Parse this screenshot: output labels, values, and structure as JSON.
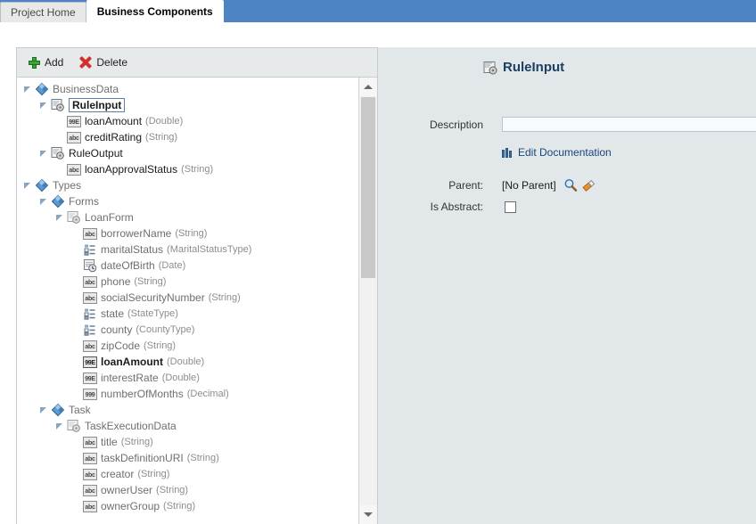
{
  "tabs": [
    {
      "label": "Project Home",
      "active": false
    },
    {
      "label": "Business Components",
      "active": true
    }
  ],
  "toolbar": {
    "add_label": "Add",
    "delete_label": "Delete"
  },
  "tree": [
    {
      "label": "BusinessData",
      "type": "",
      "indent": 0,
      "icon": "diamond",
      "twisty": "open",
      "dim": true
    },
    {
      "label": "RuleInput",
      "type": "",
      "indent": 1,
      "icon": "gear",
      "twisty": "open",
      "selected": true
    },
    {
      "label": "loanAmount",
      "type": "(Double)",
      "indent": 2,
      "icon": "num-double",
      "twisty": "none"
    },
    {
      "label": "creditRating",
      "type": "(String)",
      "indent": 2,
      "icon": "abc",
      "twisty": "none"
    },
    {
      "label": "RuleOutput",
      "type": "",
      "indent": 1,
      "icon": "gear",
      "twisty": "open"
    },
    {
      "label": "loanApprovalStatus",
      "type": "(String)",
      "indent": 2,
      "icon": "abc",
      "twisty": "none"
    },
    {
      "label": "Types",
      "type": "",
      "indent": 0,
      "icon": "diamond",
      "twisty": "open",
      "dim": true
    },
    {
      "label": "Forms",
      "type": "",
      "indent": 1,
      "icon": "diamond",
      "twisty": "open",
      "dim": true
    },
    {
      "label": "LoanForm",
      "type": "",
      "indent": 2,
      "icon": "gear-gray",
      "twisty": "open",
      "dim": true
    },
    {
      "label": "borrowerName",
      "type": "(String)",
      "indent": 3,
      "icon": "abc",
      "twisty": "none",
      "dim": true
    },
    {
      "label": "maritalStatus",
      "type": "(MaritalStatusType)",
      "indent": 3,
      "icon": "enum",
      "twisty": "none",
      "dim": true
    },
    {
      "label": "dateOfBirth",
      "type": "(Date)",
      "indent": 3,
      "icon": "date",
      "twisty": "none",
      "dim": true
    },
    {
      "label": "phone",
      "type": "(String)",
      "indent": 3,
      "icon": "abc",
      "twisty": "none",
      "dim": true
    },
    {
      "label": "socialSecurityNumber",
      "type": "(String)",
      "indent": 3,
      "icon": "abc",
      "twisty": "none",
      "dim": true
    },
    {
      "label": "state",
      "type": "(StateType)",
      "indent": 3,
      "icon": "enum",
      "twisty": "none",
      "dim": true
    },
    {
      "label": "county",
      "type": "(CountyType)",
      "indent": 3,
      "icon": "enum",
      "twisty": "none",
      "dim": true
    },
    {
      "label": "zipCode",
      "type": "(String)",
      "indent": 3,
      "icon": "abc",
      "twisty": "none",
      "dim": true
    },
    {
      "label": "loanAmount",
      "type": "(Double)",
      "indent": 3,
      "icon": "num-double-dark",
      "twisty": "none",
      "bold": true
    },
    {
      "label": "interestRate",
      "type": "(Double)",
      "indent": 3,
      "icon": "num-double",
      "twisty": "none",
      "dim": true
    },
    {
      "label": "numberOfMonths",
      "type": "(Decimal)",
      "indent": 3,
      "icon": "num-dec",
      "twisty": "none",
      "dim": true
    },
    {
      "label": "Task",
      "type": "",
      "indent": 1,
      "icon": "diamond",
      "twisty": "open",
      "dim": true
    },
    {
      "label": "TaskExecutionData",
      "type": "",
      "indent": 2,
      "icon": "gear-gray",
      "twisty": "open",
      "dim": true
    },
    {
      "label": "title",
      "type": "(String)",
      "indent": 3,
      "icon": "abc",
      "twisty": "none",
      "dim": true
    },
    {
      "label": "taskDefinitionURI",
      "type": "(String)",
      "indent": 3,
      "icon": "abc",
      "twisty": "none",
      "dim": true
    },
    {
      "label": "creator",
      "type": "(String)",
      "indent": 3,
      "icon": "abc",
      "twisty": "none",
      "dim": true
    },
    {
      "label": "ownerUser",
      "type": "(String)",
      "indent": 3,
      "icon": "abc",
      "twisty": "none",
      "dim": true
    },
    {
      "label": "ownerGroup",
      "type": "(String)",
      "indent": 3,
      "icon": "abc",
      "twisty": "none",
      "dim": true
    }
  ],
  "details": {
    "title": "RuleInput",
    "description_label": "Description",
    "description_value": "",
    "edit_documentation_label": "Edit Documentation",
    "parent_label": "Parent:",
    "parent_value": "[No Parent]",
    "is_abstract_label": "Is Abstract:",
    "is_abstract_checked": false
  },
  "colors": {
    "tabstrip": "#4d84c4",
    "panel_bg": "#e2e8ea",
    "title": "#1c3f63",
    "link": "#17457c",
    "add_green": "#3aa33a",
    "delete_red": "#d4302a"
  }
}
